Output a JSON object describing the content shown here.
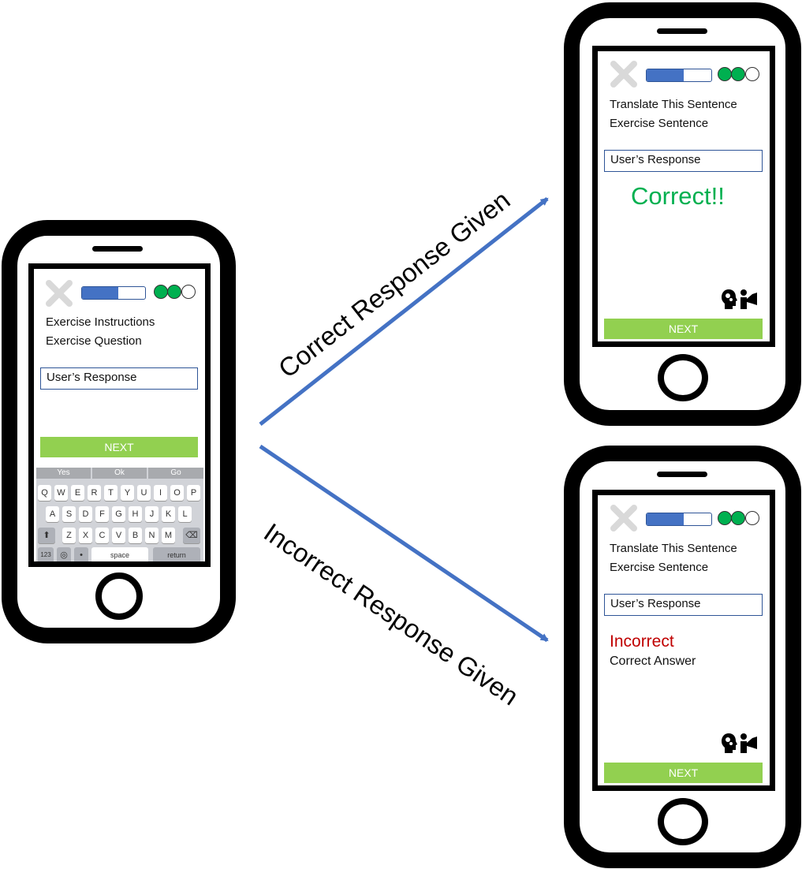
{
  "left_phone": {
    "instructions": "Exercise Instructions",
    "question": "Exercise Question",
    "response": "User’s Response",
    "next_label": "NEXT",
    "progress_fraction": 0.57,
    "dots_filled": 2,
    "suggestions": [
      "Yes",
      "Ok",
      "Go"
    ],
    "keys_row1": [
      "Q",
      "W",
      "E",
      "R",
      "T",
      "Y",
      "U",
      "I",
      "O",
      "P"
    ],
    "keys_row2": [
      "A",
      "S",
      "D",
      "F",
      "G",
      "H",
      "J",
      "K",
      "L"
    ],
    "keys_row3": [
      "Z",
      "X",
      "C",
      "V",
      "B",
      "N",
      "M"
    ],
    "key_123": "123",
    "key_space": "space",
    "key_return": "return"
  },
  "correct_phone": {
    "instructions": "Translate This Sentence",
    "sentence": "Exercise Sentence",
    "response": "User’s Response",
    "result": "Correct!!",
    "next_label": "NEXT",
    "progress_fraction": 0.57,
    "dots_filled": 2
  },
  "incorrect_phone": {
    "instructions": "Translate This Sentence",
    "sentence": "Exercise Sentence",
    "response": "User’s Response",
    "result": "Incorrect",
    "correct_answer": "Correct Answer",
    "next_label": "NEXT",
    "progress_fraction": 0.57,
    "dots_filled": 2
  },
  "arrows": {
    "correct_label": "Correct Response Given",
    "incorrect_label": "Incorrect Response Given",
    "color": "#4472c4"
  },
  "colors": {
    "progress": "#4472c4",
    "dot_filled": "#00b050",
    "next_button": "#92d050",
    "correct": "#00b050",
    "incorrect": "#c00000"
  },
  "icons": [
    "close-x-icon",
    "progress-bar",
    "progress-dots",
    "tutor-speaking-icon",
    "shift-icon",
    "backspace-icon",
    "globe-icon",
    "microphone-icon"
  ]
}
